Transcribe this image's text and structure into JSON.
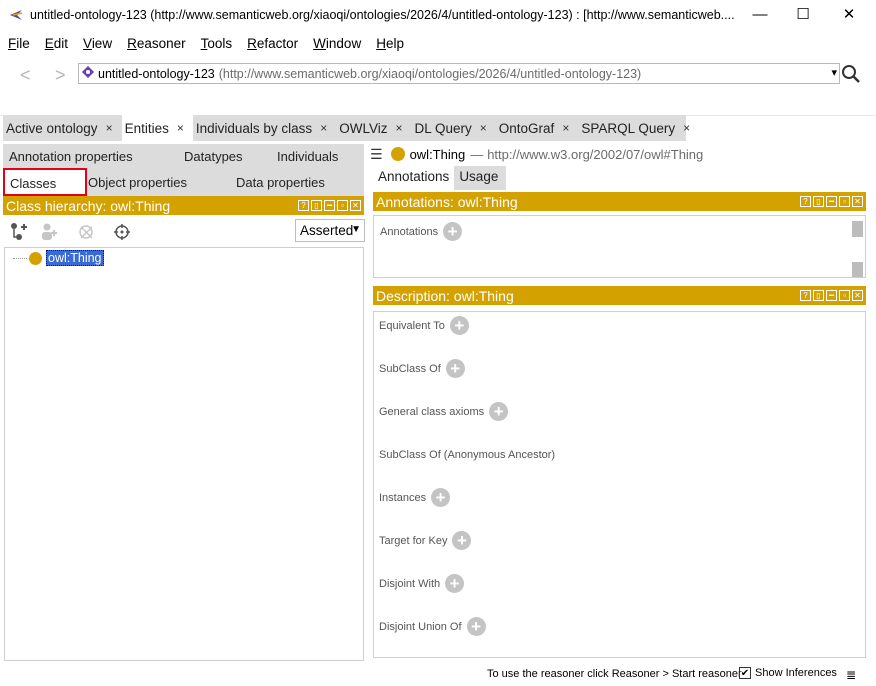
{
  "window": {
    "title": "untitled-ontology-123 (http://www.semanticweb.org/xiaoqi/ontologies/2026/4/untitled-ontology-123)  : [http://www.semanticweb....",
    "minimize": "—",
    "maximize": "☐",
    "close": "✕"
  },
  "menu": [
    {
      "label": "File",
      "u": "F",
      "rest": "ile"
    },
    {
      "label": "Edit",
      "u": "E",
      "rest": "dit"
    },
    {
      "label": "View",
      "u": "V",
      "rest": "iew"
    },
    {
      "label": "Reasoner",
      "u": "R",
      "rest": "easoner"
    },
    {
      "label": "Tools",
      "u": "T",
      "rest": "ools"
    },
    {
      "label": "Refactor",
      "u": "R",
      "rest": "efactor"
    },
    {
      "label": "Window",
      "u": "W",
      "rest": "indow"
    },
    {
      "label": "Help",
      "u": "H",
      "rest": "elp"
    }
  ],
  "address": {
    "back": "<",
    "forward": ">",
    "ontology_name": "untitled-ontology-123",
    "ontology_iri": "(http://www.semanticweb.org/xiaoqi/ontologies/2026/4/untitled-ontology-123)",
    "dropdown": "▾"
  },
  "tabs": [
    {
      "label": "Active ontology",
      "close": "×"
    },
    {
      "label": "Entities",
      "close": "×",
      "active": true
    },
    {
      "label": "Individuals by class",
      "close": "×"
    },
    {
      "label": "OWLViz",
      "close": "×"
    },
    {
      "label": "DL Query",
      "close": "×"
    },
    {
      "label": "OntoGraf",
      "close": "×"
    },
    {
      "label": "SPARQL Query",
      "close": "×"
    }
  ],
  "subtabs": {
    "annotation_properties": "Annotation properties",
    "datatypes": "Datatypes",
    "individuals": "Individuals",
    "classes": "Classes",
    "object_properties": "Object properties",
    "data_properties": "Data properties"
  },
  "class_hierarchy": {
    "header": "Class hierarchy: owl:Thing",
    "view_mode": "Asserted",
    "root": "owl:Thing"
  },
  "entity": {
    "name": "owl:Thing",
    "separator": "—",
    "iri": "http://www.w3.org/2002/07/owl#Thing"
  },
  "right_tabs": {
    "annotations": "Annotations",
    "usage": "Usage"
  },
  "annotations_panel": {
    "header": "Annotations: owl:Thing",
    "label": "Annotations"
  },
  "description_panel": {
    "header": "Description: owl:Thing",
    "sections": [
      {
        "label": "Equivalent To",
        "has_add": true
      },
      {
        "label": "SubClass Of",
        "has_add": true
      },
      {
        "label": "General class axioms",
        "has_add": true
      },
      {
        "label": "SubClass Of (Anonymous Ancestor)",
        "has_add": false
      },
      {
        "label": "Instances",
        "has_add": true
      },
      {
        "label": "Target for Key",
        "has_add": true
      },
      {
        "label": "Disjoint With",
        "has_add": true
      },
      {
        "label": "Disjoint Union Of",
        "has_add": true
      }
    ]
  },
  "header_buttons": {
    "help": "?",
    "split": "▯",
    "min": "━",
    "max": "▫",
    "close": "✕"
  },
  "status": {
    "message": "To use the reasoner click Reasoner > Start reasoner",
    "show_inferences": "Show Inferences",
    "show_inferences_checked": "✔",
    "list_icon": "≣"
  },
  "colors": {
    "accent_yellow": "#d4a200",
    "selection_blue": "#3a6ad4",
    "highlight_red": "#e3001b"
  }
}
